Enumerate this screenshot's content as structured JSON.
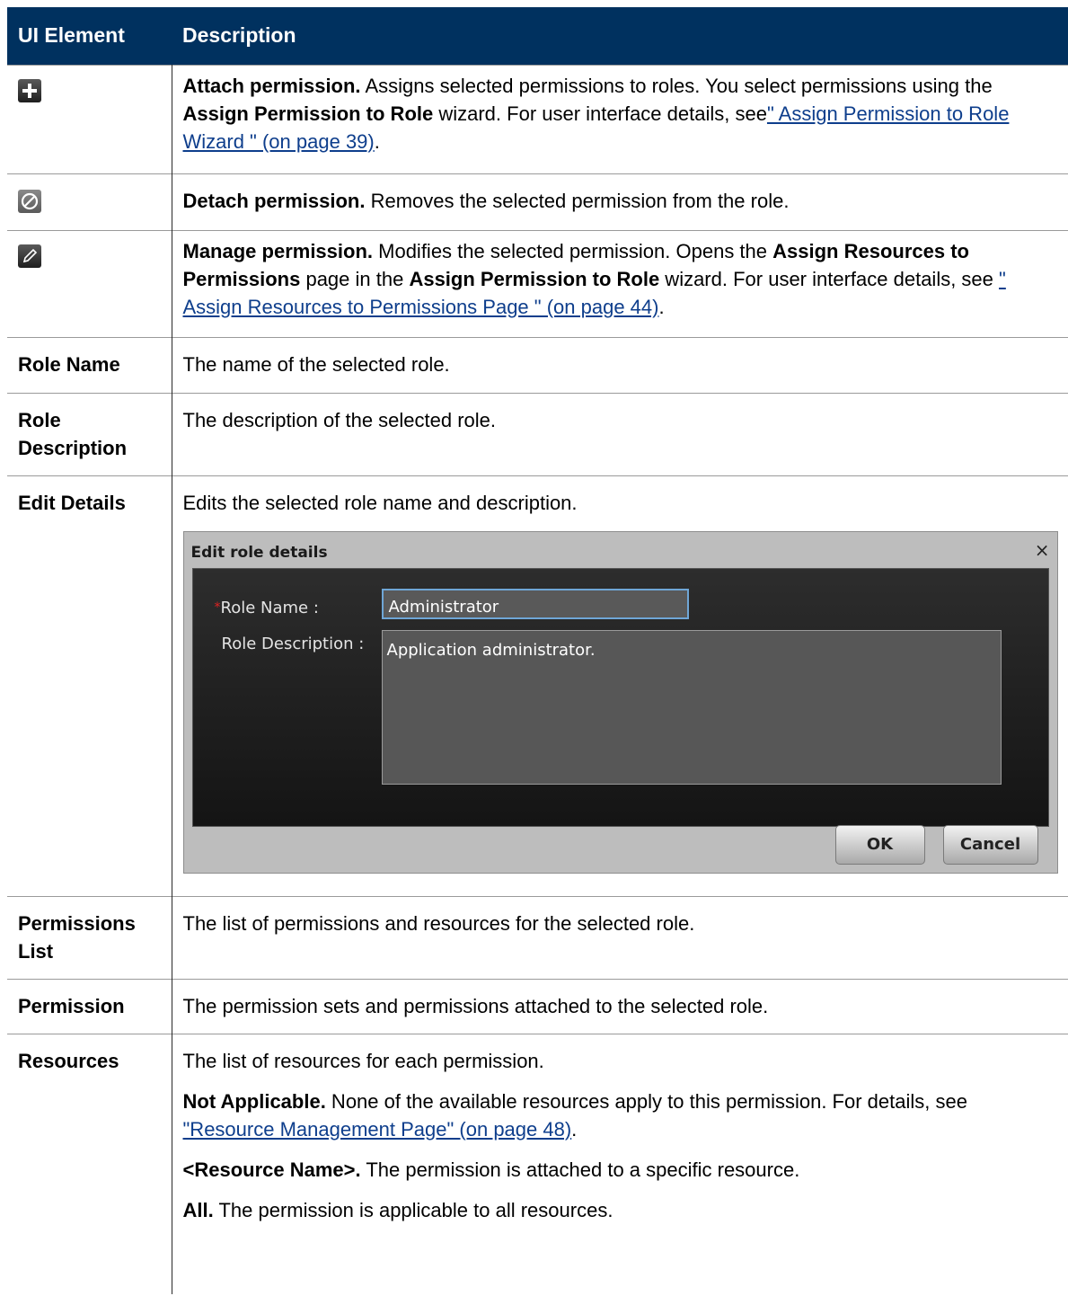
{
  "header": {
    "col1": "UI Element",
    "col2": "Description"
  },
  "icons": {
    "attach": "plus-icon",
    "detach": "no-entry-icon",
    "manage": "pencil-icon"
  },
  "rows": {
    "attach": {
      "term": "Attach permission.",
      "t1": " Assigns selected permissions to roles. You select permissions using the ",
      "b1": "Assign Permission to Role",
      "t2": " wizard. For user interface details, see",
      "link": "\" Assign Permission to Role Wizard \" (on page 39)",
      "t3": "."
    },
    "detach": {
      "term": "Detach permission.",
      "t1": " Removes the selected permission from the role."
    },
    "manage": {
      "term": "Manage permission.",
      "t1": " Modifies the selected permission. Opens the ",
      "b1": "Assign Resources to Permissions",
      "t2": " page in the ",
      "b2": "Assign Permission to Role",
      "t3": " wizard. For user interface details, see ",
      "link": "\" Assign Resources to Permissions Page \" (on page 44)",
      "t4": "."
    },
    "role_name": {
      "label": "Role Name",
      "desc": "The name of the selected role."
    },
    "role_desc": {
      "label": "Role Description",
      "desc": "The description of the selected role."
    },
    "edit_details": {
      "label": "Edit Details",
      "desc": "Edits the selected role name and description.",
      "dialog": {
        "title": "Edit role details",
        "close": "×",
        "required_mark": "*",
        "role_name_label": "Role Name :",
        "role_name_value": "Administrator",
        "role_desc_label": "Role Description :",
        "role_desc_value": "Application administrator.",
        "ok": "OK",
        "cancel": "Cancel"
      }
    },
    "perm_list": {
      "label": "Permissions List",
      "desc": "The list of permissions and resources for the selected role."
    },
    "permission": {
      "label": "Permission",
      "desc": "The permission sets and permissions attached to the selected role."
    },
    "resources": {
      "label": "Resources",
      "p1": "The list of resources for each permission.",
      "na_term": "Not Applicable.",
      "na_text": " None of the available resources apply to this permission. For details, see ",
      "na_link": "\"Resource Management Page\" (on page 48)",
      "na_end": ".",
      "rn_term": "<Resource Name>.",
      "rn_text": " The permission is attached to a specific resource.",
      "all_term": "All.",
      "all_text": " The permission is applicable to all resources."
    }
  },
  "colors": {
    "header_bg": "#00315f",
    "link": "#0e3e8c"
  }
}
